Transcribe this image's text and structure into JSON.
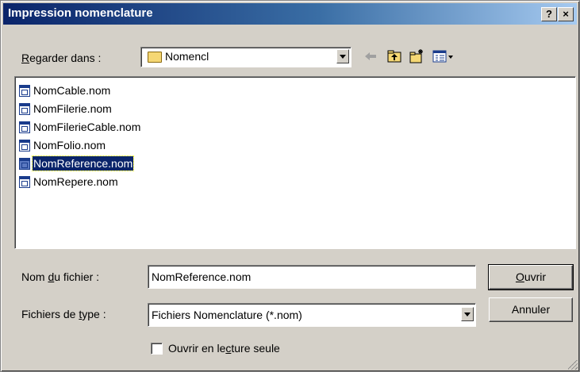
{
  "window": {
    "title": "Impression nomenclature",
    "help_label": "?",
    "close_label": "×"
  },
  "look_in": {
    "label_pre": "",
    "label_ul": "R",
    "label_post": "egarder dans :",
    "value": "Nomencl"
  },
  "toolbar": {
    "icons": [
      "back-arrow-icon",
      "up-folder-icon",
      "new-folder-icon",
      "view-menu-icon"
    ]
  },
  "files": [
    {
      "name": "NomCable.nom",
      "selected": false
    },
    {
      "name": "NomFilerie.nom",
      "selected": false
    },
    {
      "name": "NomFilerieCable.nom",
      "selected": false
    },
    {
      "name": "NomFolio.nom",
      "selected": false
    },
    {
      "name": "NomReference.nom",
      "selected": true
    },
    {
      "name": "NomRepere.nom",
      "selected": false
    }
  ],
  "filename": {
    "label_pre": "Nom ",
    "label_ul": "d",
    "label_post": "u fichier :",
    "value": "NomReference.nom"
  },
  "filetype": {
    "label_pre": "Fichiers de ",
    "label_ul": "t",
    "label_post": "ype :",
    "value": "Fichiers Nomenclature (*.nom)"
  },
  "buttons": {
    "open_ul": "O",
    "open_post": "uvrir",
    "cancel": "Annuler"
  },
  "readonly": {
    "label_pre": "Ouvrir en le",
    "label_ul": "c",
    "label_post": "ture seule",
    "checked": false
  },
  "colors": {
    "title_start": "#0a246a",
    "title_end": "#a6caf0",
    "selection": "#0a246a",
    "face": "#d4d0c8"
  }
}
